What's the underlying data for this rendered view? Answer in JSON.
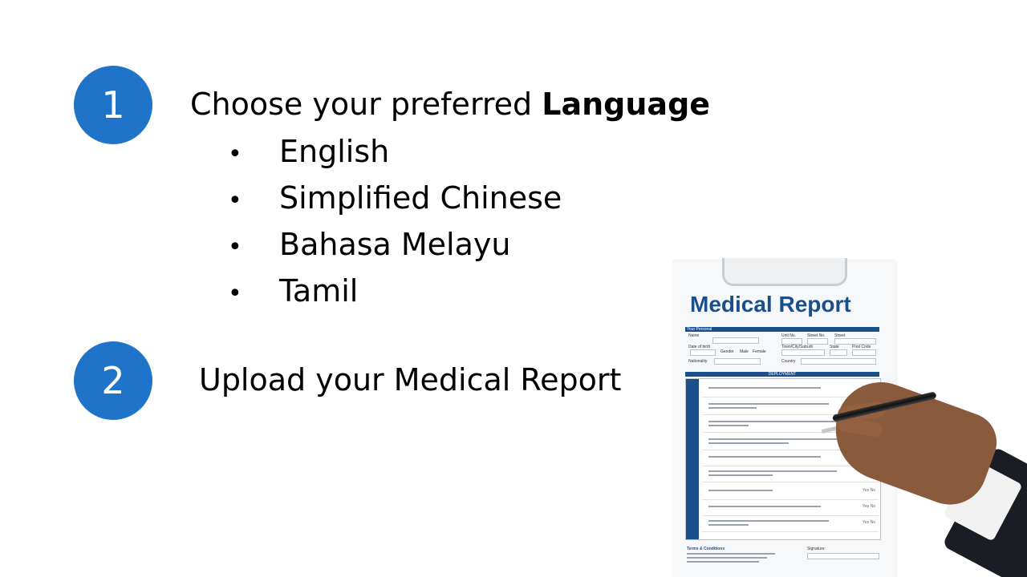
{
  "steps": [
    {
      "number": "1",
      "text_prefix": "Choose your preferred ",
      "text_bold": "Language",
      "options": [
        "English",
        "Simplified Chinese",
        "Bahasa Melayu",
        "Tamil"
      ]
    },
    {
      "number": "2",
      "text": "Upload your Medical Report"
    }
  ],
  "bullet": "•",
  "illustration": {
    "title": "Medical Report",
    "sections": {
      "personal": "Your Personal",
      "deployment": "DEPLOYMENT",
      "terms": "Terms & Conditions",
      "signature": "Signature:"
    },
    "fields": {
      "name": "Name",
      "unit_no": "Unit No.",
      "street_no": "Street No.",
      "street": "Street",
      "dob": "Date of birth",
      "gender": "Gender",
      "male": "Male",
      "female": "Female",
      "town": "Town/City/Suburb",
      "state": "State",
      "post_code": "Post Code",
      "nationality": "Nationality",
      "country": "Country"
    },
    "yes_label": "Yes",
    "no_label": "No",
    "colors": {
      "title": "#1b4f8c",
      "circle": "#1f74c9"
    }
  }
}
